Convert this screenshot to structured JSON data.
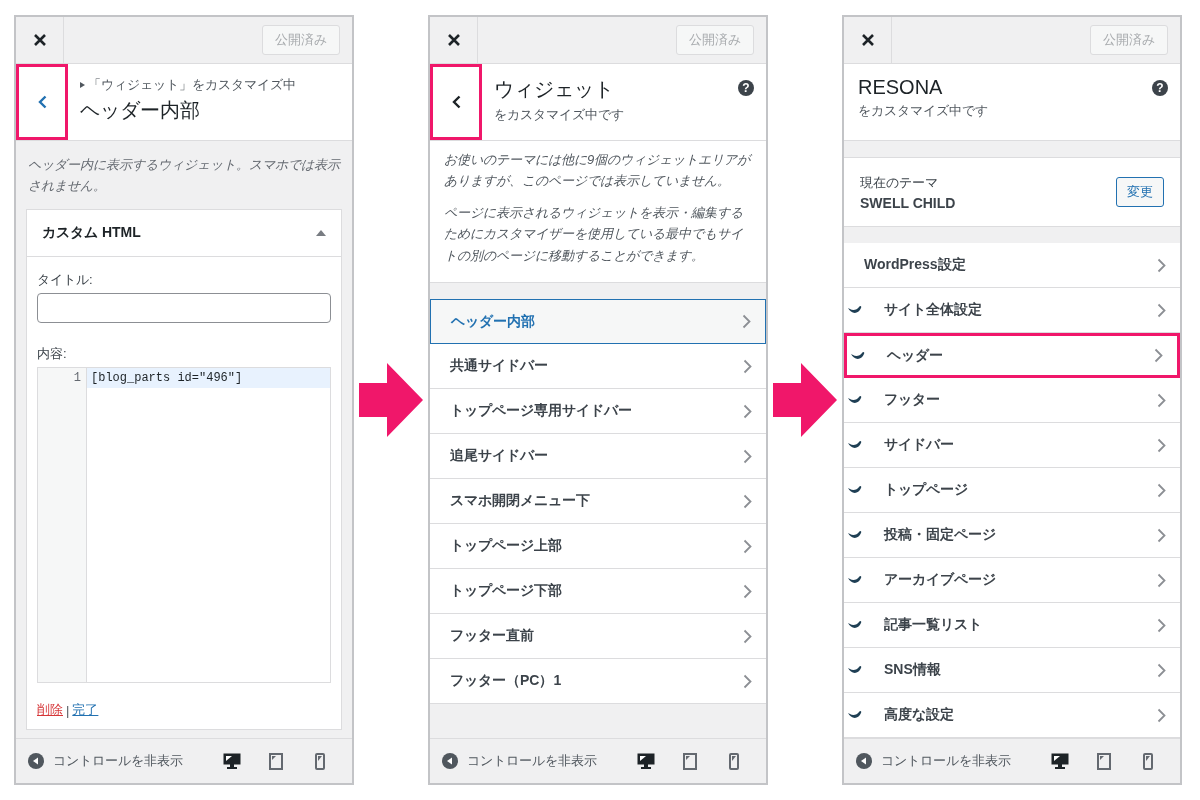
{
  "panels": [
    {
      "kind": "widget_editor",
      "publish_button": "公開済み",
      "back_highlighted": true,
      "breadcrumb": "「ウィジェット」をカスタマイズ中",
      "title": "ヘッダー内部",
      "description": "ヘッダー内に表示するウィジェット。スマホでは表示されません。",
      "widget": {
        "title": "カスタム HTML",
        "expanded": true,
        "title_label": "タイトル:",
        "content_label": "内容:",
        "code_lines": [
          {
            "number": "1",
            "text": "[blog_parts id=\"496\"]"
          }
        ],
        "delete_link": "削除",
        "separator": "|",
        "done_link": "完了"
      },
      "footer": {
        "hide_controls": "コントロールを非表示",
        "devices": [
          {
            "kind": "desktop",
            "selected": true
          },
          {
            "kind": "tablet",
            "selected": false
          },
          {
            "kind": "mobile",
            "selected": false
          }
        ]
      }
    },
    {
      "kind": "section_list",
      "publish_button": "公開済み",
      "back_highlighted": true,
      "title": "ウィジェット",
      "subtitle": "をカスタマイズ中です",
      "help": "?",
      "notes": [
        "お使いのテーマには他に9個のウィジェットエリアがありますが、このページでは表示していません。",
        "ページに表示されるウィジェットを表示・編集するためにカスタマイザーを使用している最中でもサイトの別のページに移動することができます。"
      ],
      "items": [
        {
          "label": "ヘッダー内部",
          "selected": true,
          "highlighted": false,
          "icon": false
        },
        {
          "label": "共通サイドバー",
          "selected": false,
          "highlighted": false,
          "icon": false
        },
        {
          "label": "トップページ専用サイドバー",
          "selected": false,
          "highlighted": false,
          "icon": false
        },
        {
          "label": "追尾サイドバー",
          "selected": false,
          "highlighted": false,
          "icon": false
        },
        {
          "label": "スマホ開閉メニュー下",
          "selected": false,
          "highlighted": false,
          "icon": false
        },
        {
          "label": "トップページ上部",
          "selected": false,
          "highlighted": false,
          "icon": false
        },
        {
          "label": "トップページ下部",
          "selected": false,
          "highlighted": false,
          "icon": false
        },
        {
          "label": "フッター直前",
          "selected": false,
          "highlighted": false,
          "icon": false
        },
        {
          "label": "フッター（PC）1",
          "selected": false,
          "highlighted": false,
          "icon": false
        }
      ],
      "footer": {
        "hide_controls": "コントロールを非表示",
        "devices": [
          {
            "kind": "desktop",
            "selected": true
          },
          {
            "kind": "tablet",
            "selected": false
          },
          {
            "kind": "mobile",
            "selected": false
          }
        ]
      }
    },
    {
      "kind": "root",
      "publish_button": "公開済み",
      "title": "RESONA",
      "subtitle": "をカスタマイズ中です",
      "help": "?",
      "theme": {
        "label": "現在のテーマ",
        "name": "SWELL CHILD",
        "button": "変更"
      },
      "items": [
        {
          "label": "WordPress設定",
          "selected": false,
          "highlighted": false,
          "icon": false
        },
        {
          "label": "サイト全体設定",
          "selected": false,
          "highlighted": false,
          "icon": true
        },
        {
          "label": "ヘッダー",
          "selected": false,
          "highlighted": true,
          "icon": true
        },
        {
          "label": "フッター",
          "selected": false,
          "highlighted": false,
          "icon": true
        },
        {
          "label": "サイドバー",
          "selected": false,
          "highlighted": false,
          "icon": true
        },
        {
          "label": "トップページ",
          "selected": false,
          "highlighted": false,
          "icon": true
        },
        {
          "label": "投稿・固定ページ",
          "selected": false,
          "highlighted": false,
          "icon": true
        },
        {
          "label": "アーカイブページ",
          "selected": false,
          "highlighted": false,
          "icon": true
        },
        {
          "label": "記事一覧リスト",
          "selected": false,
          "highlighted": false,
          "icon": true
        },
        {
          "label": "SNS情報",
          "selected": false,
          "highlighted": false,
          "icon": true
        },
        {
          "label": "高度な設定",
          "selected": false,
          "highlighted": false,
          "icon": true
        }
      ],
      "footer": {
        "hide_controls": "コントロールを非表示",
        "devices": [
          {
            "kind": "desktop",
            "selected": true
          },
          {
            "kind": "tablet",
            "selected": false
          },
          {
            "kind": "mobile",
            "selected": false
          }
        ]
      }
    }
  ]
}
